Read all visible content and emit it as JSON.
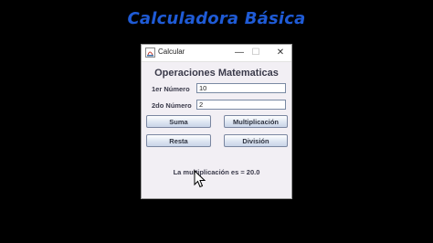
{
  "video": {
    "title": "Calculadora Básica"
  },
  "window": {
    "title": "Calcular",
    "controls": {
      "minimize": "—",
      "maximize": "☐",
      "close": "✕"
    }
  },
  "form": {
    "heading": "Operaciones Matematicas",
    "num1_label": "1er Número",
    "num1_value": "10",
    "num2_label": "2do Número",
    "num2_value": "2"
  },
  "buttons": {
    "sum": "Suma",
    "multiply": "Multiplicación",
    "subtract": "Resta",
    "divide": "División"
  },
  "result": "La multiplicación es = 20.0",
  "colors": {
    "title_blue": "#1f5bd6",
    "window_bg": "#f2eff4"
  }
}
